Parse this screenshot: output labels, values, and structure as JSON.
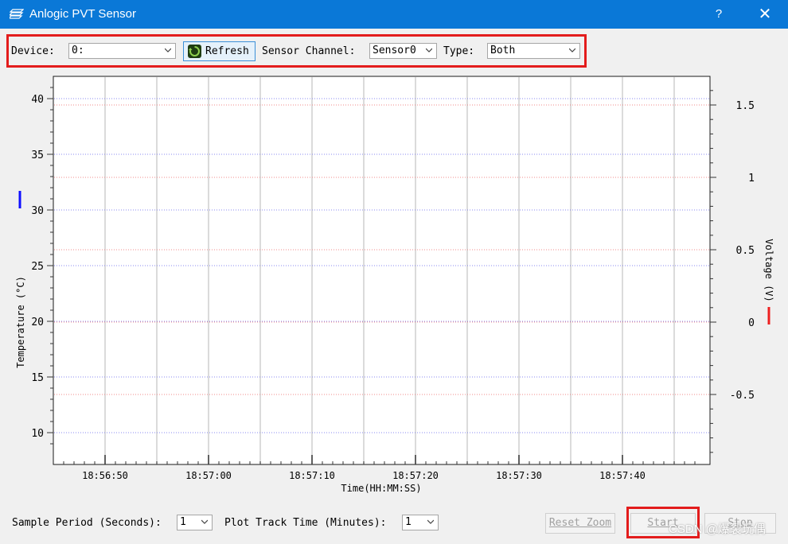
{
  "window": {
    "title": "Anlogic PVT Sensor",
    "help": "?",
    "close": "✕"
  },
  "toolbar": {
    "device_label": "Device:",
    "device_value": "0:",
    "refresh_label": "Refresh",
    "channel_label": "Sensor Channel:",
    "channel_value": "Sensor0",
    "type_label": "Type:",
    "type_value": "Both"
  },
  "chart_data": {
    "type": "line",
    "xlabel": "Time(HH:MM:SS)",
    "ylabel_left": "Temperature (°C)",
    "ylabel_right": "Voltage (V)",
    "x_ticks": [
      "18:56:50",
      "18:57:00",
      "18:57:10",
      "18:57:20",
      "18:57:30",
      "18:57:40"
    ],
    "y_left_ticks": [
      10,
      15,
      20,
      25,
      30,
      35,
      40
    ],
    "y_right_ticks": [
      "-0.5",
      "0",
      "0.5",
      "1",
      "1.5"
    ],
    "series": [],
    "grid": true,
    "colors": {
      "temperature": "#1010ff",
      "voltage": "#ee2020",
      "temp_grid": "#8a8af0",
      "volt_grid": "#f08a8a"
    }
  },
  "footer": {
    "sample_label": "Sample Period (Seconds):",
    "sample_value": "1",
    "track_label": "Plot Track Time (Minutes):",
    "track_value": "1",
    "reset_zoom": "Reset Zoom",
    "start": "Start",
    "stop": "Stop"
  },
  "watermark": "CSDN @爆裂玩偶"
}
